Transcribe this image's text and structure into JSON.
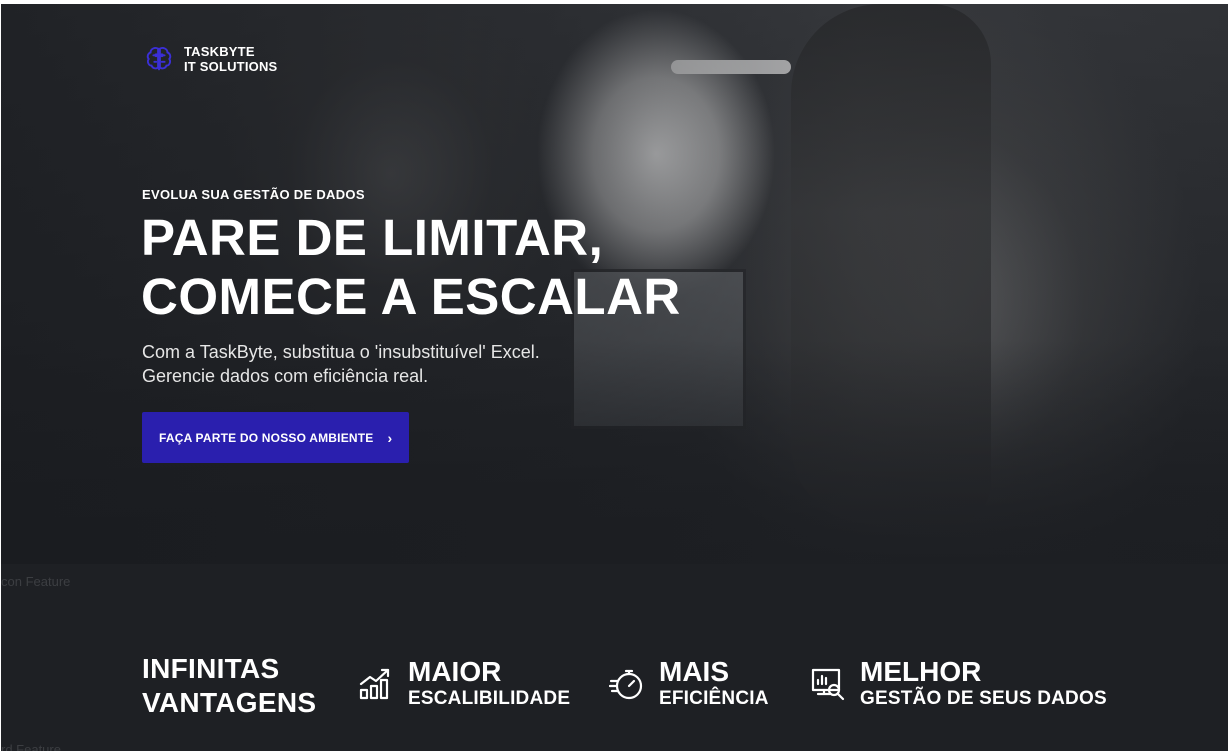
{
  "brand": {
    "line1": "TASKBYTE",
    "line2": "IT SOLUTIONS",
    "icon": "brain-icon",
    "accent_color": "#2a1fae"
  },
  "hero": {
    "eyebrow": "EVOLUA SUA GESTÃO DE DADOS",
    "headline_line1": "PARE DE LIMITAR,",
    "headline_line2": "COMECE A ESCALAR",
    "sub_line1": "Com a TaskByte, substitua o 'insubstituível' Excel.",
    "sub_line2": "Gerencie dados com eficiência real.",
    "cta_label": "FAÇA PARTE DO NOSSO AMBIENTE",
    "cta_icon": "chevron-right-icon"
  },
  "ghost": {
    "feature_label_1": "con Feature",
    "feature_label_2": "rd Feature"
  },
  "features": {
    "title_line1": "INFINITAS",
    "title_line2": "VANTAGENS",
    "items": [
      {
        "icon": "growth-chart-icon",
        "big": "MAIOR",
        "small": "ESCALIBILIDADE"
      },
      {
        "icon": "stopwatch-icon",
        "big": "MAIS",
        "small": "EFICIÊNCIA"
      },
      {
        "icon": "monitor-search-icon",
        "big": "MELHOR",
        "small": "GESTÃO DE SEUS DADOS"
      }
    ]
  }
}
